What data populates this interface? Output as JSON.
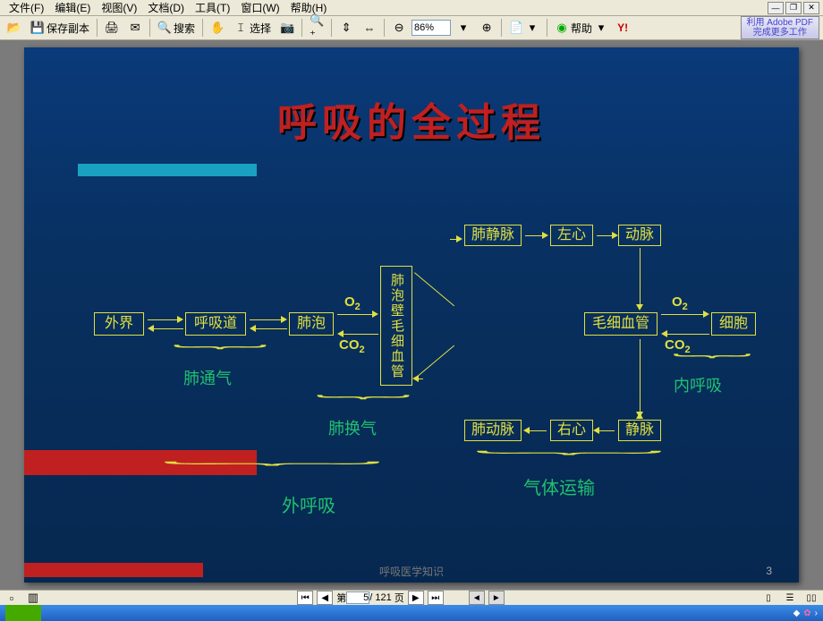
{
  "menu": {
    "file": "文件(F)",
    "edit": "编辑(E)",
    "view": "视图(V)",
    "document": "文档(D)",
    "tools": "工具(T)",
    "window": "窗口(W)",
    "help": "帮助(H)"
  },
  "toolbar": {
    "save_copy": "保存副本",
    "search": "搜索",
    "select": "选择",
    "help": "帮助",
    "zoom": "86%",
    "adobe_line1": "利用 Adobe PDF",
    "adobe_line2": "完成更多工作"
  },
  "pager": {
    "prefix": "第",
    "current": "5",
    "sep": "/",
    "total": "121",
    "suffix": "页"
  },
  "footer_text": "呼吸医学知识",
  "footer_num": "3",
  "slide": {
    "title": "呼吸的全过程",
    "boxes": {
      "waijie": "外界",
      "huxidao": "呼吸道",
      "feipao": "肺泡",
      "feipao_capillary": "肺泡壁毛细血管",
      "feijingmai": "肺静脉",
      "zuoxin": "左心",
      "dongmai": "动脉",
      "feidongmai": "肺动脉",
      "youxin": "右心",
      "jingmai": "静脉",
      "maoxixueguan": "毛细血管",
      "xibao": "细胞"
    },
    "gas": {
      "o2": "O",
      "o2_sub": "2",
      "co2": "CO",
      "co2_sub": "2"
    },
    "labels": {
      "feitongqi": "肺通气",
      "feihuanqi": "肺换气",
      "waihuxi": "外呼吸",
      "neihuxi": "内呼吸",
      "qitiyunshu": "气体运输"
    }
  }
}
